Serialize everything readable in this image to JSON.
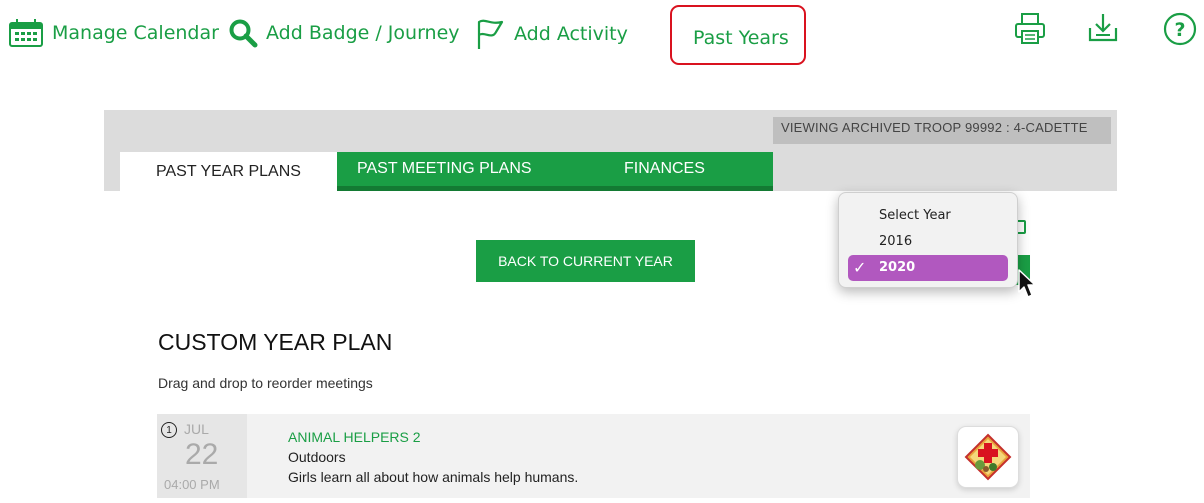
{
  "toolbar": {
    "manage_calendar": "Manage Calendar",
    "add_badge_journey": "Add Badge / Journey",
    "add_activity": "Add Activity",
    "past_years": "Past Years"
  },
  "utility_icons": [
    "print-icon",
    "download-icon",
    "help-icon"
  ],
  "archive_banner": "VIEWING ARCHIVED TROOP 99992 : 4-CADETTE",
  "tabs": [
    {
      "label": "PAST YEAR PLANS",
      "active": true
    },
    {
      "label": "PAST MEETING PLANS",
      "active": false
    },
    {
      "label": "FINANCES",
      "active": false
    }
  ],
  "back_button": "BACK TO CURRENT YEAR",
  "year_select": {
    "options": [
      "Select Year",
      "2016",
      "2020"
    ],
    "selected": "2020",
    "check": "✓"
  },
  "plan": {
    "title": "CUSTOM YEAR PLAN",
    "subtitle": "Drag and drop to reorder meetings"
  },
  "meetings": [
    {
      "number": "1",
      "month": "JUL",
      "day": "22",
      "time": "04:00 PM",
      "title": "ANIMAL HELPERS 2",
      "category": "Outdoors",
      "description": "Girls learn all about how animals help humans.",
      "badge_icon": "animal-helpers-badge-icon"
    }
  ],
  "colors": {
    "brand_green": "#1a9e45",
    "highlight_red": "#d9121f",
    "selected_purple": "#b158bf",
    "band_gray": "#dcdcdc"
  }
}
